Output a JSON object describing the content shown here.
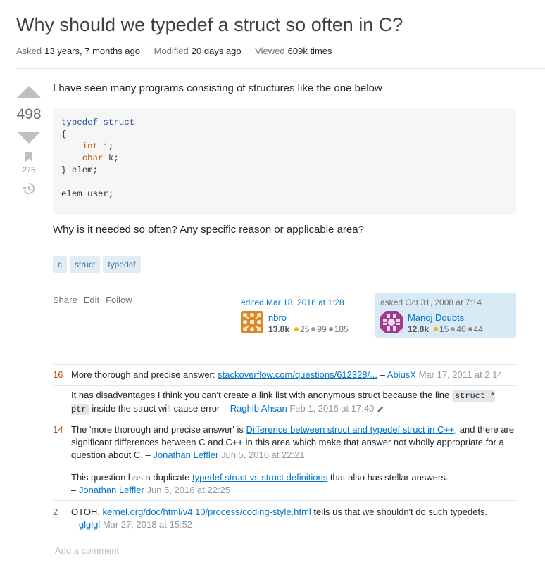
{
  "question": {
    "title": "Why should we typedef a struct so often in C?",
    "meta": {
      "asked_label": "Asked",
      "asked_value": "13 years, 7 months ago",
      "modified_label": "Modified",
      "modified_value": "20 days ago",
      "viewed_label": "Viewed",
      "viewed_value": "609k times"
    },
    "votes": "498",
    "bookmarks": "275",
    "body_p1": "I have seen many programs consisting of structures like the one below",
    "code": {
      "kw_typedef": "typedef",
      "kw_struct": "struct",
      "open": "{",
      "int": "int",
      "int_rest": " i;",
      "char": "char",
      "char_rest": " k;",
      "close": "} elem;",
      "last": "elem user;"
    },
    "body_p2": "Why is it needed so often? Any specific reason or applicable area?",
    "tags": [
      "c",
      "struct",
      "typedef"
    ],
    "menu": {
      "share": "Share",
      "edit": "Edit",
      "follow": "Follow"
    },
    "edited": {
      "label": "edited Mar 18, 2016 at 1:28",
      "user": "nbro",
      "rep": "13.8k",
      "gold": "25",
      "silver": "99",
      "bronze": "185"
    },
    "asked": {
      "label": "asked Oct 31, 2008 at 7:14",
      "user": "Manoj Doubts",
      "rep": "12.8k",
      "gold": "15",
      "silver": "40",
      "bronze": "44"
    }
  },
  "comments": [
    {
      "score": "16",
      "text": "More thorough and precise answer: ",
      "link": "stackoverflow.com/questions/612328/...",
      "author_sep": " – ",
      "author": "AbiusX",
      "time": "Mar 17, 2011 at 2:14"
    },
    {
      "score": "",
      "text1": "It has disadvantages I think you can't create a link list with anonymous struct because the line ",
      "code": "struct * ptr",
      "text2": " inside the struct will cause error – ",
      "author": "Raghib Ahsan",
      "time": "Feb 1, 2016 at 17:40"
    },
    {
      "score": "14",
      "text1": "The 'more thorough and precise answer' is ",
      "link": "Difference between struct and typedef struct in C++",
      "text2": ", and there are significant differences between C and C++ in this area which make that answer not wholly appropriate for a question about C. – ",
      "author": "Jonathan Leffler",
      "time": "Jun 5, 2016 at 22:21"
    },
    {
      "score": "",
      "text1": "This question has a duplicate ",
      "link": "typedef struct vs struct definitions",
      "text2": " that also has stellar answers.",
      "dash": "– ",
      "author": "Jonathan Leffler",
      "time": "Jun 5, 2016 at 22:25"
    },
    {
      "score": "2",
      "text1": "OTOH, ",
      "link": "kernel.org/doc/html/v4.10/process/coding-style.html",
      "text2": " tells us that we shouldn't do such typedefs.",
      "dash": "– ",
      "author": "glglgl",
      "time": "Mar 27, 2018 at 15:52"
    }
  ],
  "add_comment": "Add a comment",
  "colors": {
    "gold": "#f1b600",
    "silver": "#9a9c9f",
    "bronze": "#ab825f",
    "link": "#0074cc",
    "score_hot": "#c04a00"
  }
}
